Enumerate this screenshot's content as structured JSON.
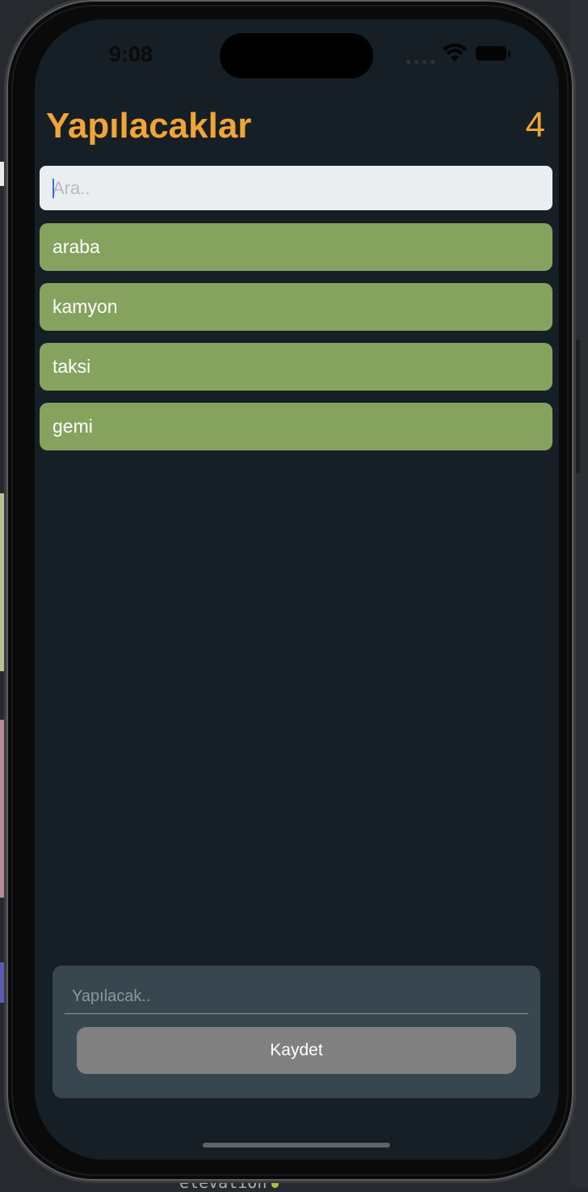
{
  "status_bar": {
    "time": "9:08"
  },
  "header": {
    "title": "Yapılacaklar",
    "count": "4"
  },
  "search": {
    "placeholder": "Ara..",
    "value": ""
  },
  "todos": [
    {
      "label": "araba"
    },
    {
      "label": "kamyon"
    },
    {
      "label": "taksi"
    },
    {
      "label": "gemi"
    }
  ],
  "form": {
    "placeholder": "Yapılacak..",
    "save_label": "Kaydet"
  },
  "background": {
    "bottom_code": "elevation"
  },
  "colors": {
    "accent": "#f2a535",
    "item_bg": "#85a35e",
    "screen_bg": "#161f26",
    "form_bg": "#38464f",
    "button_bg": "#808080"
  }
}
